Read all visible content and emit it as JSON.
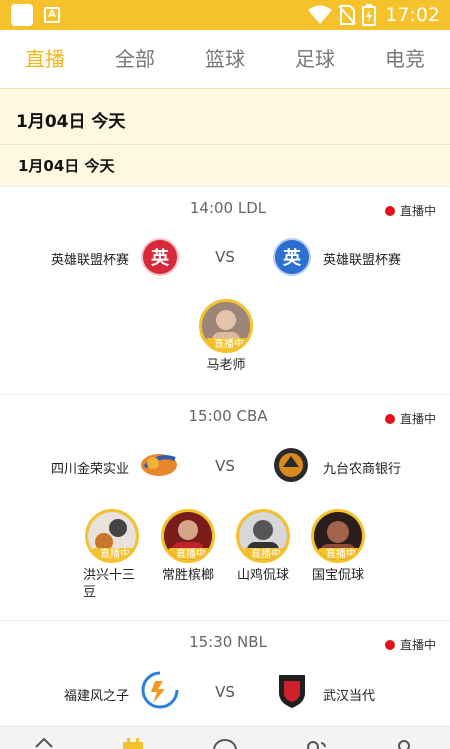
{
  "status_bar": {
    "time": "17:02",
    "notification_letter": "A"
  },
  "tabs": [
    {
      "label": "直播",
      "active": true
    },
    {
      "label": "全部",
      "active": false
    },
    {
      "label": "篮球",
      "active": false
    },
    {
      "label": "足球",
      "active": false
    },
    {
      "label": "电竞",
      "active": false
    }
  ],
  "date_header": {
    "primary": "1月04日 今天",
    "secondary": "1月04日  今天"
  },
  "matches": [
    {
      "time_league": "14:00 LDL",
      "live_label": "直播中",
      "home": {
        "name": "英雄联盟杯赛",
        "logo_char": "英",
        "logo_color": "#d8283a"
      },
      "vs": "VS",
      "away": {
        "name": "英雄联盟杯赛",
        "logo_char": "英",
        "logo_color": "#2d6fd0"
      },
      "anchors": [
        {
          "name": "马老师",
          "tag": "直播中"
        }
      ]
    },
    {
      "time_league": "15:00 CBA",
      "live_label": "直播中",
      "home": {
        "name": "四川金荣实业"
      },
      "vs": "VS",
      "away": {
        "name": "九台农商银行"
      },
      "anchors": [
        {
          "name": "洪兴十三豆",
          "tag": "直播中"
        },
        {
          "name": "常胜槟榔",
          "tag": "直播中"
        },
        {
          "name": "山鸡侃球",
          "tag": "直播中"
        },
        {
          "name": "国宝侃球",
          "tag": "直播中"
        }
      ]
    },
    {
      "time_league": "15:30 NBL",
      "live_label": "直播中",
      "home": {
        "name": "福建风之子"
      },
      "vs": "VS",
      "away": {
        "name": "武汉当代"
      }
    }
  ],
  "colors": {
    "accent": "#f6c22b",
    "live_dot": "#e0121b",
    "date_bg": "#fff8e0"
  }
}
